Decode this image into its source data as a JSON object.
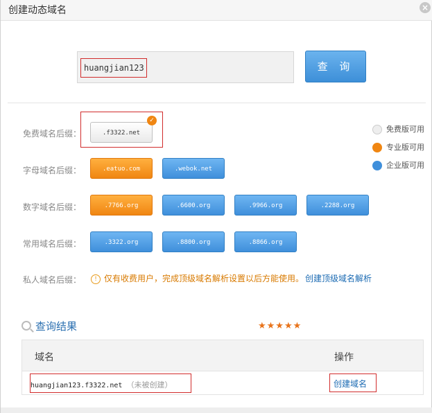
{
  "dialog": {
    "title": "创建动态域名",
    "close_glyph": "×"
  },
  "search": {
    "value": "huangjian123",
    "button_label": "查 询"
  },
  "rows": {
    "free": {
      "label": "免费域名后缀：",
      "items": [
        ".f3322.net"
      ]
    },
    "letter": {
      "label": "字母域名后缀：",
      "items": [
        ".eatuo.com",
        ".webok.net"
      ]
    },
    "number": {
      "label": "数字域名后缀：",
      "items": [
        ".7766.org",
        ".6600.org",
        ".9966.org",
        ".2288.org"
      ]
    },
    "common": {
      "label": "常用域名后缀：",
      "items": [
        ".3322.org",
        ".8800.org",
        ".8866.org"
      ]
    },
    "private": {
      "label": "私人域名后缀：",
      "note": "仅有收费用户，完成顶级域名解析设置以后方能使用。",
      "link": "创建顶级域名解析",
      "info_glyph": "!"
    }
  },
  "legend": [
    {
      "label": "免费版可用",
      "color": "#eeeeee"
    },
    {
      "label": "专业版可用",
      "color": "#f08612"
    },
    {
      "label": "企业版可用",
      "color": "#3f8fdb"
    }
  ],
  "results": {
    "title": "查询结果",
    "stars": "★★★★★",
    "columns": [
      "域名",
      "操作"
    ],
    "row": {
      "domain": "huangjian123.f3322.net",
      "status": "（未被创建）",
      "action": "创建域名"
    }
  },
  "selected_check": "✓"
}
